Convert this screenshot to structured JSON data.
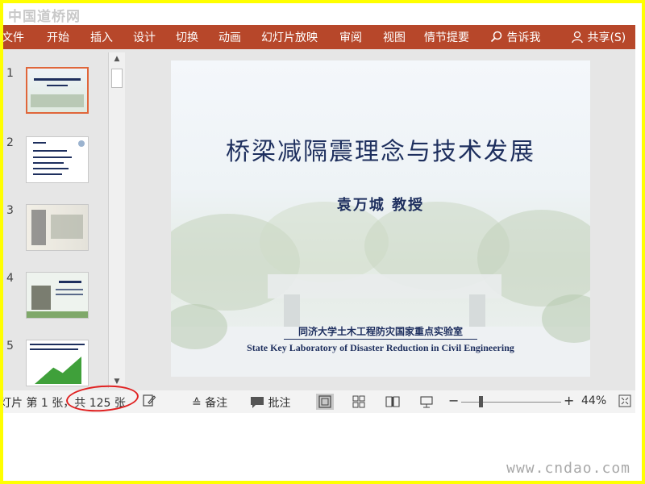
{
  "watermark_top": "中国道桥网",
  "ribbon": {
    "tabs": [
      "文件",
      "开始",
      "插入",
      "设计",
      "切换",
      "动画",
      "幻灯片放映",
      "审阅",
      "视图",
      "情节提要"
    ],
    "tell_me": "告诉我",
    "share": "共享(S)"
  },
  "thumbnails": {
    "numbers": [
      "1",
      "2",
      "3",
      "4",
      "5"
    ],
    "selected": 1
  },
  "slide": {
    "title": "桥梁减隔震理念与技术发展",
    "author": "袁万城 教授",
    "lab_cn": "同济大学土木工程防灾国家重点实验室",
    "lab_en": "State Key Laboratory of Disaster Reduction in Civil Engineering"
  },
  "statusbar": {
    "slide_info": "灯片 第 1 张，共 125 张",
    "notes": "备注",
    "comments": "批注",
    "zoom": "44%"
  },
  "annotation_color": "#e02020",
  "ribbon_color": "#b7472a",
  "watermark_bottom": "www.cndao.com",
  "icons": [
    "search-icon",
    "user-icon",
    "notes-icon",
    "comments-icon",
    "normal-view-icon",
    "slide-sorter-icon",
    "reading-view-icon",
    "slideshow-icon",
    "fit-window-icon"
  ]
}
